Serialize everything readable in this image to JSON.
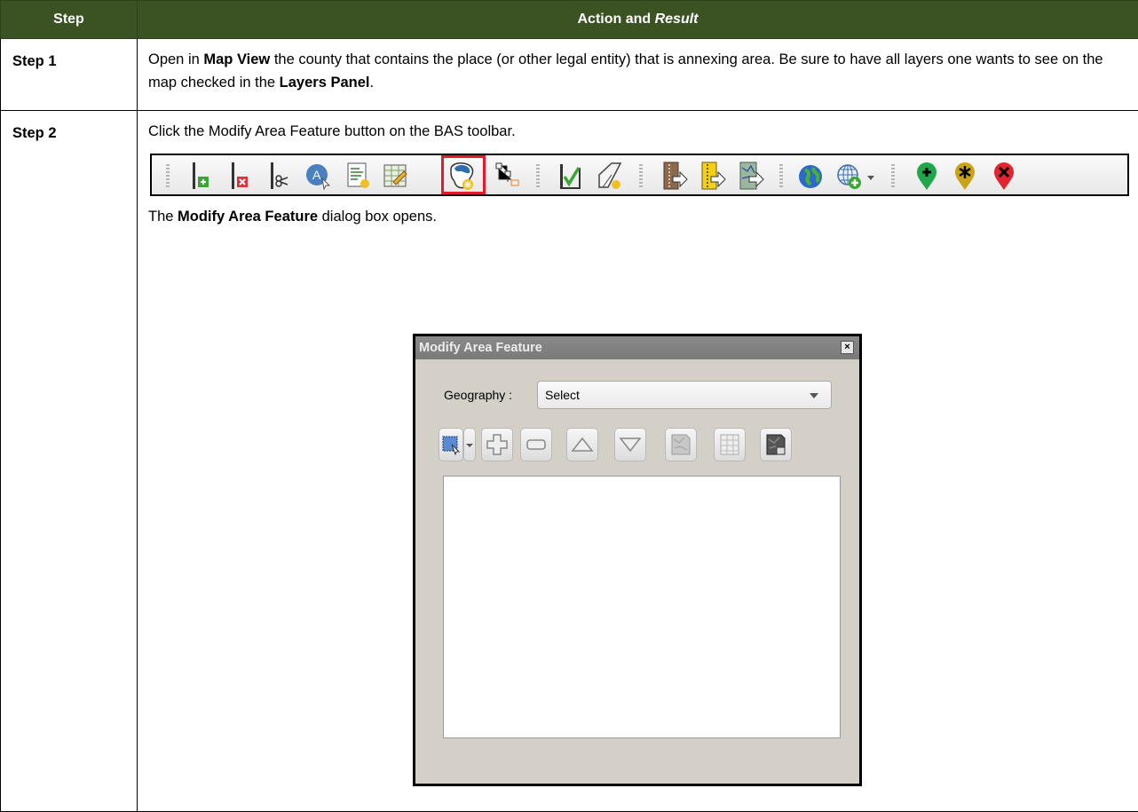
{
  "table": {
    "headers": {
      "step": "Step",
      "action": "Action and ",
      "result": "Result"
    },
    "rows": [
      {
        "step": "Step 1",
        "parts": [
          "Open in ",
          "Map View",
          " the county that contains the place (or other legal entity) that is annexing area. Be sure to have all layers one wants to see on the map checked in the ",
          "Layers Panel",
          "."
        ]
      },
      {
        "step": "Step 2",
        "instruction": "Click the Modify Area Feature button on the BAS toolbar.",
        "result_parts": [
          "The ",
          "Modify Area Feature",
          " dialog box opens."
        ]
      }
    ]
  },
  "toolbar": {
    "icons": [
      "add-line-icon",
      "delete-line-icon",
      "split-line-icon",
      "address-point-icon",
      "attribute-form-icon",
      "edit-table-icon",
      "modify-area-feature-icon",
      "topology-icon",
      "validate-icon",
      "new-polygon-icon",
      "import-icon",
      "export-icon",
      "export-map-icon",
      "globe-icon",
      "add-web-layer-icon",
      "add-point-icon",
      "move-point-icon",
      "delete-point-icon"
    ],
    "highlighted": "modify-area-feature-icon",
    "highlight_color": "#e11b2b"
  },
  "dialog": {
    "title": "Modify Area Feature",
    "close_glyph": "×",
    "geography_label": "Geography :",
    "geography_value": "Select",
    "tools": [
      "select-tool-icon",
      "add-icon",
      "remove-icon",
      "move-up-icon",
      "move-down-icon",
      "map-extent-icon",
      "table-icon",
      "clear-icon"
    ]
  },
  "colors": {
    "header_bg": "#3b5323",
    "header_text": "#ffffff"
  }
}
